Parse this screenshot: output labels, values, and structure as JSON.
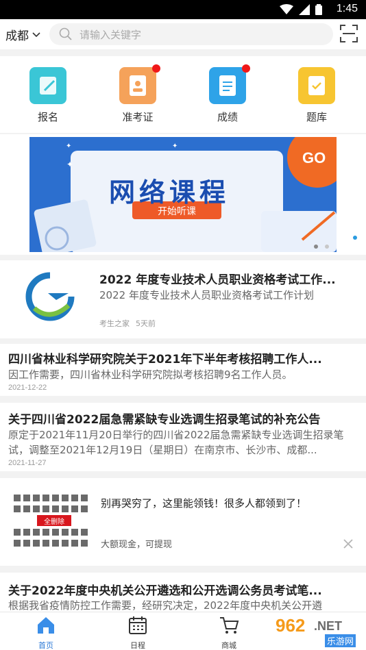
{
  "status": {
    "time": "1:45"
  },
  "header": {
    "city": "成都",
    "search_placeholder": "请输入关键字"
  },
  "quick_nav": [
    {
      "label": "报名",
      "color": "#3ac6d6",
      "icon": "edit-icon",
      "badge": false
    },
    {
      "label": "准考证",
      "color": "#f5a25a",
      "icon": "id-card-icon",
      "badge": true
    },
    {
      "label": "成绩",
      "color": "#2ea3e8",
      "icon": "score-sheet-icon",
      "badge": true
    },
    {
      "label": "题库",
      "color": "#f7c531",
      "icon": "question-bank-icon",
      "badge": false
    }
  ],
  "banner": {
    "title": "网络课程",
    "button": "开始听课",
    "go": "GO"
  },
  "featured": {
    "title": "2022 年度专业技术人员职业资格考试工作...",
    "summary": "2022 年度专业技术人员职业资格考试工作计划",
    "source": "考生之家",
    "time": "5天前"
  },
  "articles": [
    {
      "title": "四川省林业科学研究院关于2021年下半年考核招聘工作人...",
      "summary": "因工作需要，四川省林业科学研究院拟考核招聘9名工作人员。",
      "date": "2021-12-22"
    },
    {
      "title": "关于四川省2022届急需紧缺专业选调生招录笔试的补充公告",
      "summary": "原定于2021年11月20日举行的四川省2022届急需紧缺专业选调生招录笔试，调整至2021年12月19日（星期日）在南京市、长沙市、成都...",
      "date": "2021-11-27"
    },
    {
      "title": "关于2022年度中央机关公开遴选和公开选调公务员考试笔...",
      "summary": "根据我省疫情防控工作需要，经研究决定，2022年度中央机关公开遴"
    }
  ],
  "ad": {
    "title": "别再哭穷了，这里能领钱！很多人都领到了！",
    "subtitle": "大额现金，可提现",
    "overlay_label": "全删除"
  },
  "tabs": [
    {
      "label": "首页",
      "icon": "home-icon",
      "active": true
    },
    {
      "label": "日程",
      "icon": "calendar-icon",
      "active": false
    },
    {
      "label": "商城",
      "icon": "cart-icon",
      "active": false
    }
  ],
  "watermark": {
    "main": "962",
    "suffix": ".NET",
    "sub": "乐游网"
  },
  "colors": {
    "accent": "#2a78d6",
    "badge": "#f01818",
    "banner_blue": "#2c6fcf",
    "go_orange": "#f06a24"
  }
}
